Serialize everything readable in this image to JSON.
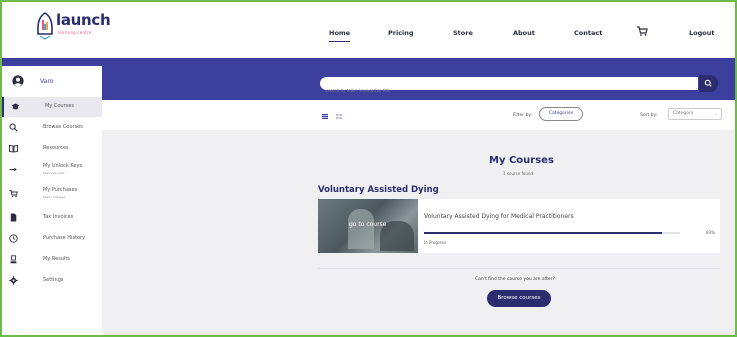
{
  "brand": {
    "name": "launch",
    "tagline": "learning centre",
    "colors": {
      "primary": "#2b2d6e",
      "banner": "#3d3f9e",
      "accent": "#e85a8a"
    }
  },
  "nav": {
    "items": [
      {
        "label": "Home",
        "active": true
      },
      {
        "label": "Pricing",
        "active": false
      },
      {
        "label": "Store",
        "active": false
      },
      {
        "label": "About",
        "active": false
      },
      {
        "label": "Contact",
        "active": false
      }
    ],
    "cart_icon": "cart-icon",
    "logout_label": "Logout"
  },
  "search": {
    "placeholder": "search by topic, keyword or title"
  },
  "sidebar": {
    "user_name": "Varo",
    "items": [
      {
        "label": "My Courses",
        "icon": "graduation-cap-icon",
        "active": true
      },
      {
        "label": "Browse Courses",
        "icon": "search-icon"
      },
      {
        "label": "Resources",
        "icon": "book-icon"
      },
      {
        "label": "My Unlock Keys",
        "sub": "Keys I've used",
        "icon": "key-arrow-icon"
      },
      {
        "label": "My Purchases",
        "sub": "Keys I manage",
        "icon": "cart-icon"
      },
      {
        "label": "Tax Invoices",
        "icon": "document-icon"
      },
      {
        "label": "Purchase History",
        "icon": "clock-icon"
      },
      {
        "label": "My Results",
        "icon": "award-icon"
      },
      {
        "label": "Settings",
        "icon": "gear-icon"
      }
    ]
  },
  "toolbar": {
    "filter_label": "Filter by:",
    "filter_value": "Categories",
    "sort_label": "Sort by:",
    "sort_value": "Category"
  },
  "main": {
    "title": "My Courses",
    "subtitle": "1 course found",
    "section": "Voluntary Assisted Dying",
    "course": {
      "thumb_label": "go to course",
      "name": "Voluntary Assisted Dying for Medical Practitioners",
      "progress": 93,
      "progress_label": "93%",
      "status": "In Progress"
    },
    "cant_find": "Can't find the course you are after?",
    "browse_button": "Browse courses"
  }
}
